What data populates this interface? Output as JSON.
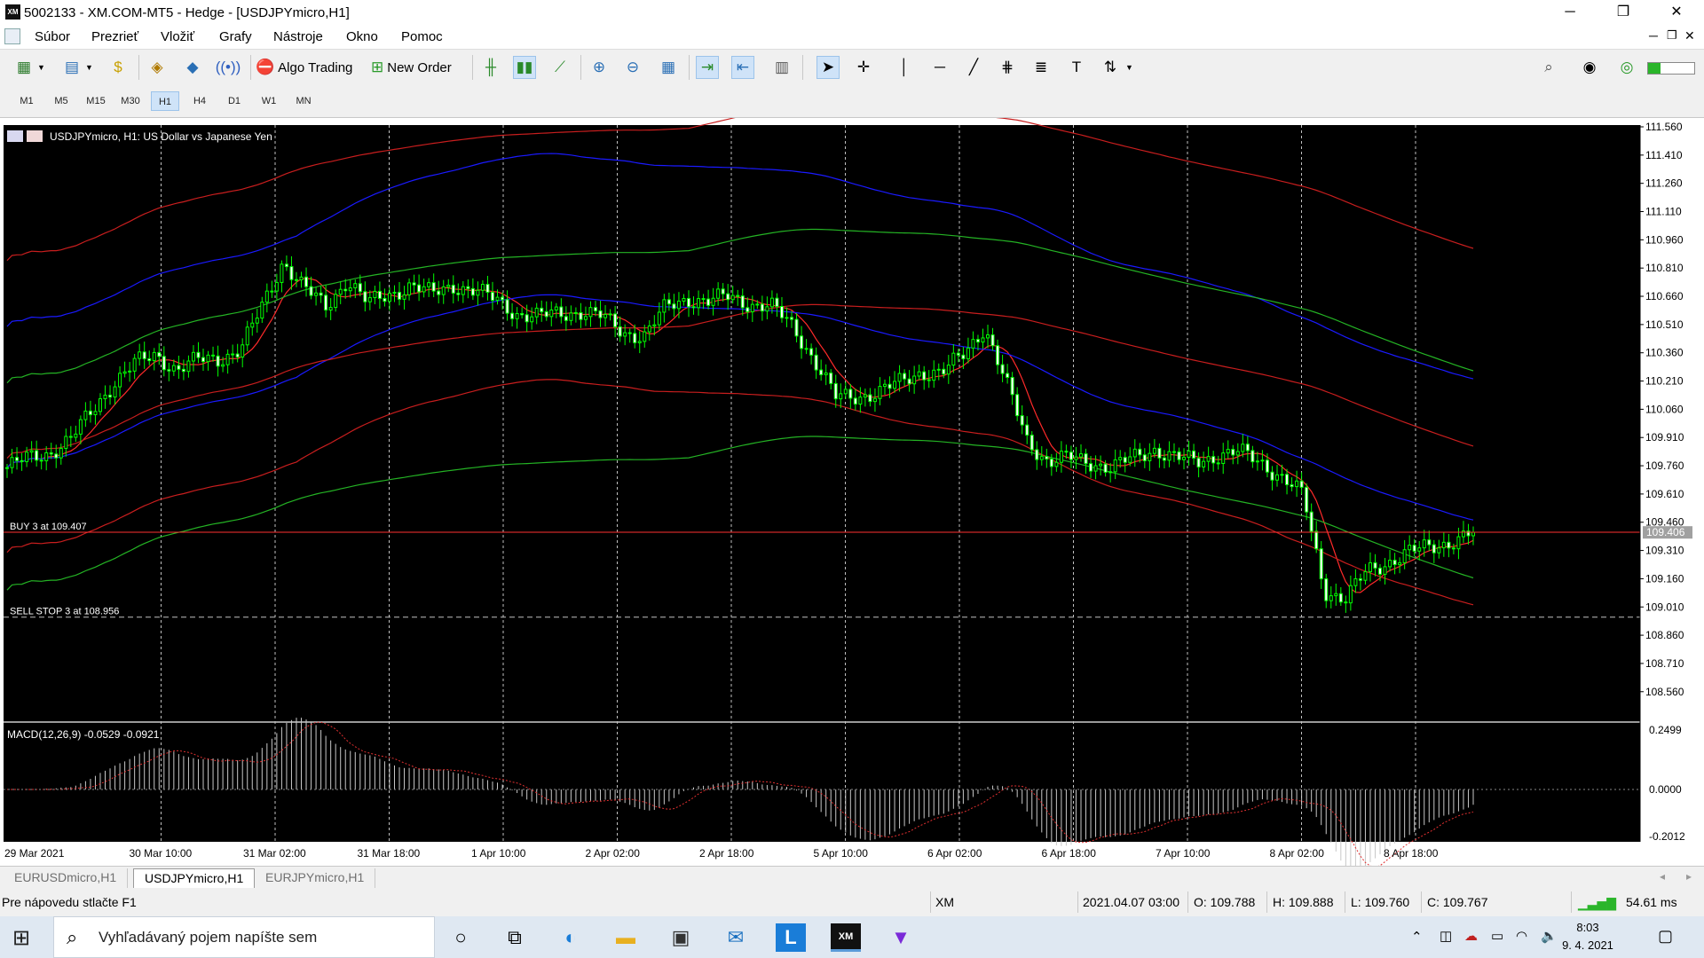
{
  "window": {
    "title": "5002133 - XM.COM-MT5 - Hedge - [USDJPYmicro,H1]",
    "app_icon": "XM",
    "controls": [
      "minimize-icon",
      "restore-icon",
      "close-icon"
    ]
  },
  "menu": {
    "items": [
      "Súbor",
      "Prezrieť",
      "Vložiť",
      "Grafy",
      "Nástroje",
      "Okno",
      "Pomoc"
    ]
  },
  "toolbar": {
    "algo_trading_label": "Algo Trading",
    "new_order_label": "New Order"
  },
  "timeframes": {
    "items": [
      "M1",
      "M5",
      "M15",
      "M30",
      "H1",
      "H4",
      "D1",
      "W1",
      "MN"
    ],
    "active": "H1"
  },
  "chart": {
    "header": "USDJPYmicro, H1:  US Dollar vs Japanese Yen",
    "order_buy_label": "BUY 3 at 109.407",
    "order_sell_label": "SELL STOP 3 at 108.956",
    "current_price_label": "109.406",
    "macd_label": "MACD(12,26,9) -0.0529 -0.0921",
    "colors": {
      "background": "#000000",
      "candle": "#00ff00",
      "ma_red": "#ff2a2a",
      "bb_blue": "#1a1aff",
      "bb_green": "#24b324",
      "bb_red": "#c81e1e",
      "grid": "#c0c0c0",
      "order_line": "#ff3030"
    }
  },
  "chart_data": {
    "type": "candlestick",
    "symbol": "USDJPYmicro",
    "timeframe": "H1",
    "price_axis_ticks": [
      "111.560",
      "111.410",
      "111.260",
      "111.110",
      "110.960",
      "110.810",
      "110.660",
      "110.510",
      "110.360",
      "110.210",
      "110.060",
      "109.910",
      "109.760",
      "109.610",
      "109.460",
      "109.310",
      "109.160",
      "109.010",
      "108.860",
      "108.710",
      "108.560"
    ],
    "price_range": [
      108.46,
      111.56
    ],
    "macd_axis_ticks": [
      "0.2499",
      "0.0000",
      "-0.2012"
    ],
    "time_axis_ticks": [
      "29 Mar 2021",
      "30 Mar 10:00",
      "31 Mar 02:00",
      "31 Mar 18:00",
      "1 Apr 10:00",
      "2 Apr 02:00",
      "2 Apr 18:00",
      "5 Apr 10:00",
      "6 Apr 02:00",
      "6 Apr 18:00",
      "7 Apr 10:00",
      "8 Apr 02:00",
      "8 Apr 18:00"
    ],
    "close_path": [
      109.75,
      109.8,
      109.83,
      109.9,
      110.05,
      110.2,
      110.3,
      110.35,
      110.27,
      110.32,
      110.33,
      110.38,
      110.6,
      110.85,
      110.7,
      110.6,
      110.75,
      110.62,
      110.67,
      110.72,
      110.67,
      110.72,
      110.69,
      110.64,
      110.57,
      110.55,
      110.57,
      110.58,
      110.55,
      110.47,
      110.45,
      110.6,
      110.65,
      110.63,
      110.66,
      110.62,
      110.6,
      110.5,
      110.32,
      110.12,
      110.13,
      110.15,
      110.2,
      110.26,
      110.25,
      110.35,
      110.5,
      110.2,
      109.9,
      109.78,
      109.8,
      109.78,
      109.75,
      109.8,
      109.85,
      109.8,
      109.78,
      109.82,
      109.83,
      109.78,
      109.7,
      109.6,
      109.1,
      109.05,
      109.2,
      109.25,
      109.3,
      109.33,
      109.36,
      109.4
    ],
    "order_levels": {
      "buy": 109.407,
      "sell_stop": 108.956
    },
    "current_price": 109.406
  },
  "tabs": {
    "items": [
      "EURUSDmicro,H1",
      "USDJPYmicro,H1",
      "EURJPYmicro,H1"
    ],
    "active": "USDJPYmicro,H1"
  },
  "status": {
    "help": "Pre nápovedu stlačte F1",
    "profile": "XM",
    "datetime": "2021.04.07 03:00",
    "open": "O: 109.788",
    "high": "H: 109.888",
    "low": "L: 109.760",
    "close": "C: 109.767",
    "ping": "54.61 ms"
  },
  "taskbar": {
    "search_placeholder": "Vyhľadávaný pojem napíšte sem",
    "time": "8:03",
    "date": "9. 4. 2021"
  }
}
